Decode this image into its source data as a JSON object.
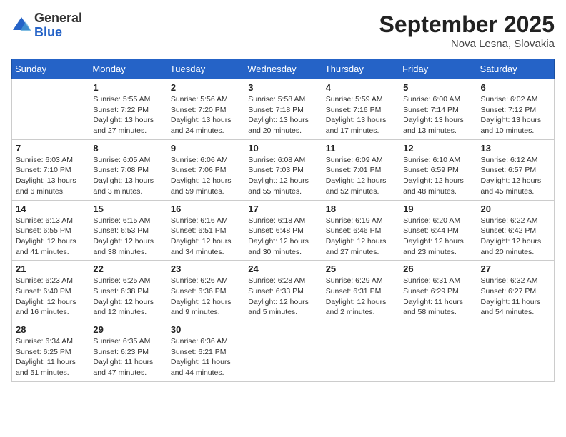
{
  "header": {
    "logo_general": "General",
    "logo_blue": "Blue",
    "month_title": "September 2025",
    "location": "Nova Lesna, Slovakia"
  },
  "days_of_week": [
    "Sunday",
    "Monday",
    "Tuesday",
    "Wednesday",
    "Thursday",
    "Friday",
    "Saturday"
  ],
  "weeks": [
    [
      {
        "day": "",
        "info": ""
      },
      {
        "day": "1",
        "info": "Sunrise: 5:55 AM\nSunset: 7:22 PM\nDaylight: 13 hours\nand 27 minutes."
      },
      {
        "day": "2",
        "info": "Sunrise: 5:56 AM\nSunset: 7:20 PM\nDaylight: 13 hours\nand 24 minutes."
      },
      {
        "day": "3",
        "info": "Sunrise: 5:58 AM\nSunset: 7:18 PM\nDaylight: 13 hours\nand 20 minutes."
      },
      {
        "day": "4",
        "info": "Sunrise: 5:59 AM\nSunset: 7:16 PM\nDaylight: 13 hours\nand 17 minutes."
      },
      {
        "day": "5",
        "info": "Sunrise: 6:00 AM\nSunset: 7:14 PM\nDaylight: 13 hours\nand 13 minutes."
      },
      {
        "day": "6",
        "info": "Sunrise: 6:02 AM\nSunset: 7:12 PM\nDaylight: 13 hours\nand 10 minutes."
      }
    ],
    [
      {
        "day": "7",
        "info": "Sunrise: 6:03 AM\nSunset: 7:10 PM\nDaylight: 13 hours\nand 6 minutes."
      },
      {
        "day": "8",
        "info": "Sunrise: 6:05 AM\nSunset: 7:08 PM\nDaylight: 13 hours\nand 3 minutes."
      },
      {
        "day": "9",
        "info": "Sunrise: 6:06 AM\nSunset: 7:06 PM\nDaylight: 12 hours\nand 59 minutes."
      },
      {
        "day": "10",
        "info": "Sunrise: 6:08 AM\nSunset: 7:03 PM\nDaylight: 12 hours\nand 55 minutes."
      },
      {
        "day": "11",
        "info": "Sunrise: 6:09 AM\nSunset: 7:01 PM\nDaylight: 12 hours\nand 52 minutes."
      },
      {
        "day": "12",
        "info": "Sunrise: 6:10 AM\nSunset: 6:59 PM\nDaylight: 12 hours\nand 48 minutes."
      },
      {
        "day": "13",
        "info": "Sunrise: 6:12 AM\nSunset: 6:57 PM\nDaylight: 12 hours\nand 45 minutes."
      }
    ],
    [
      {
        "day": "14",
        "info": "Sunrise: 6:13 AM\nSunset: 6:55 PM\nDaylight: 12 hours\nand 41 minutes."
      },
      {
        "day": "15",
        "info": "Sunrise: 6:15 AM\nSunset: 6:53 PM\nDaylight: 12 hours\nand 38 minutes."
      },
      {
        "day": "16",
        "info": "Sunrise: 6:16 AM\nSunset: 6:51 PM\nDaylight: 12 hours\nand 34 minutes."
      },
      {
        "day": "17",
        "info": "Sunrise: 6:18 AM\nSunset: 6:48 PM\nDaylight: 12 hours\nand 30 minutes."
      },
      {
        "day": "18",
        "info": "Sunrise: 6:19 AM\nSunset: 6:46 PM\nDaylight: 12 hours\nand 27 minutes."
      },
      {
        "day": "19",
        "info": "Sunrise: 6:20 AM\nSunset: 6:44 PM\nDaylight: 12 hours\nand 23 minutes."
      },
      {
        "day": "20",
        "info": "Sunrise: 6:22 AM\nSunset: 6:42 PM\nDaylight: 12 hours\nand 20 minutes."
      }
    ],
    [
      {
        "day": "21",
        "info": "Sunrise: 6:23 AM\nSunset: 6:40 PM\nDaylight: 12 hours\nand 16 minutes."
      },
      {
        "day": "22",
        "info": "Sunrise: 6:25 AM\nSunset: 6:38 PM\nDaylight: 12 hours\nand 12 minutes."
      },
      {
        "day": "23",
        "info": "Sunrise: 6:26 AM\nSunset: 6:36 PM\nDaylight: 12 hours\nand 9 minutes."
      },
      {
        "day": "24",
        "info": "Sunrise: 6:28 AM\nSunset: 6:33 PM\nDaylight: 12 hours\nand 5 minutes."
      },
      {
        "day": "25",
        "info": "Sunrise: 6:29 AM\nSunset: 6:31 PM\nDaylight: 12 hours\nand 2 minutes."
      },
      {
        "day": "26",
        "info": "Sunrise: 6:31 AM\nSunset: 6:29 PM\nDaylight: 11 hours\nand 58 minutes."
      },
      {
        "day": "27",
        "info": "Sunrise: 6:32 AM\nSunset: 6:27 PM\nDaylight: 11 hours\nand 54 minutes."
      }
    ],
    [
      {
        "day": "28",
        "info": "Sunrise: 6:34 AM\nSunset: 6:25 PM\nDaylight: 11 hours\nand 51 minutes."
      },
      {
        "day": "29",
        "info": "Sunrise: 6:35 AM\nSunset: 6:23 PM\nDaylight: 11 hours\nand 47 minutes."
      },
      {
        "day": "30",
        "info": "Sunrise: 6:36 AM\nSunset: 6:21 PM\nDaylight: 11 hours\nand 44 minutes."
      },
      {
        "day": "",
        "info": ""
      },
      {
        "day": "",
        "info": ""
      },
      {
        "day": "",
        "info": ""
      },
      {
        "day": "",
        "info": ""
      }
    ]
  ]
}
